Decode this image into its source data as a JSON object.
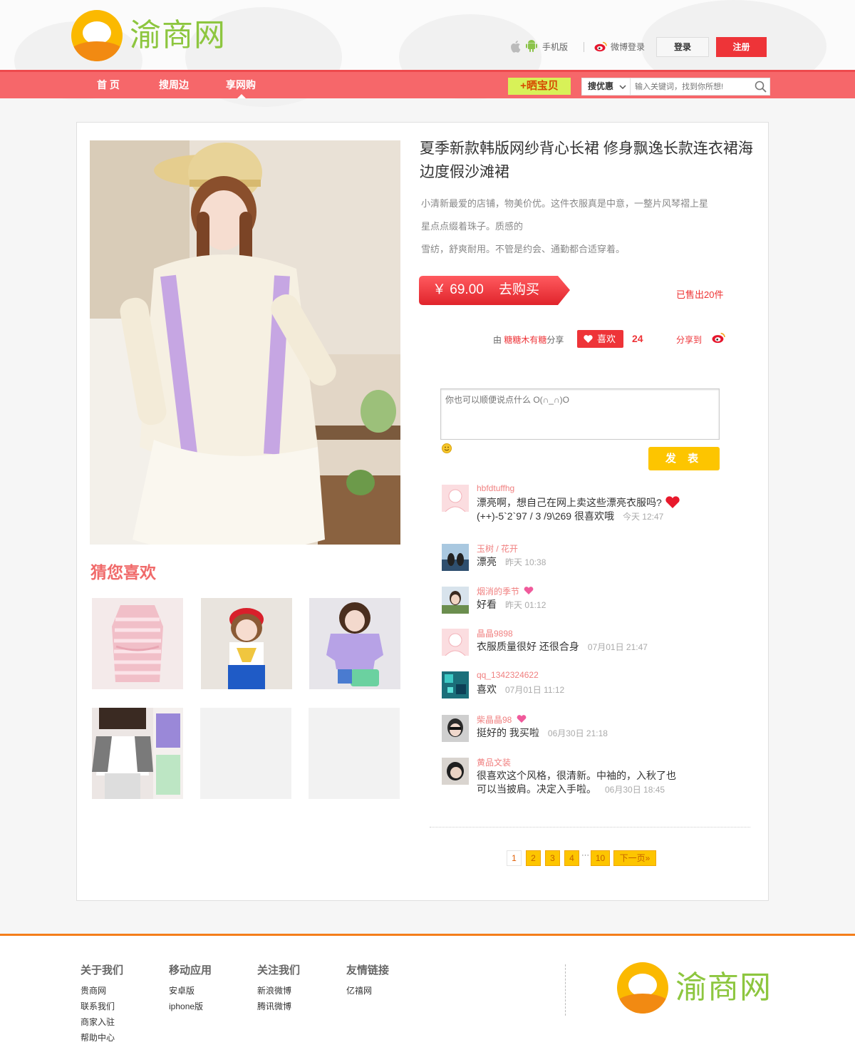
{
  "header": {
    "logo_text": "渝商网",
    "mobile_label": "手机版",
    "weibo_login_label": "微博登录",
    "login_button": "登录",
    "register_button": "注册"
  },
  "nav": {
    "items": [
      {
        "label": "首 页"
      },
      {
        "label": "搜周边"
      },
      {
        "label": "享网购"
      }
    ],
    "share_button": "+晒宝贝",
    "search_select": "搜优惠",
    "search_placeholder": "输入关键词，找到你所想!"
  },
  "product": {
    "title": "夏季新款韩版网纱背心长裙 修身飘逸长款连衣裙海边度假沙滩裙",
    "description_lines": [
      "小清新最爱的店铺，物美价优。这件衣服真是中意，一整片风琴褶上星",
      "星点点缀着珠子。质感的",
      "雪纺，舒爽耐用。不管是约会、通勤都合适穿着。"
    ],
    "price": "￥ 69.00",
    "buy_label": "去购买",
    "sold": "已售出20件",
    "shared_by_prefix": "由",
    "shared_by_user": "糖糖木有糖",
    "shared_by_suffix": "分享",
    "like_label": "喜欢",
    "like_count": "24",
    "share_to_label": "分享到"
  },
  "comment_form": {
    "placeholder": "你也可以顺便说点什么 O(∩_∩)O",
    "submit_label": "发 表"
  },
  "comments": [
    {
      "name": "hbfdtuffhg",
      "line1": "漂亮啊，想自己在网上卖这些漂亮衣服吗?",
      "line2": "(++)-5`2`97 / 3 /9\\269 很喜欢哦",
      "time": "今天 12:47"
    },
    {
      "name": "玉树 / 花开",
      "text": "漂亮",
      "time": "昨天 10:38"
    },
    {
      "name": "烟消的季节",
      "text": "好看",
      "time": "昨天 01:12"
    },
    {
      "name": "晶晶9898",
      "text": "衣服质量很好 还很合身",
      "time": "07月01日 21:47"
    },
    {
      "name": "qq_1342324622",
      "text": "喜欢",
      "time": "07月01日 11:12"
    },
    {
      "name": "柴晶晶98",
      "text": "挺好的 我买啦",
      "time": "06月30日 21:18"
    },
    {
      "name": "黄品文装",
      "line1": "很喜欢这个风格，很清新。中袖的，入秋了也",
      "line2": "可以当披肩。决定入手啦。",
      "time": "06月30日 18:45"
    }
  ],
  "pagination": {
    "pages": [
      "1",
      "2",
      "3",
      "4"
    ],
    "ellipsis": "···",
    "last": "10",
    "next": "下一页»",
    "current": "1"
  },
  "guess": {
    "title": "猜您喜欢"
  },
  "footer": {
    "columns": [
      {
        "title": "关于我们",
        "links": [
          "贵商网",
          "联系我们",
          "商家入驻",
          "帮助中心"
        ]
      },
      {
        "title": "移动应用",
        "links": [
          "安卓版",
          "iphone版"
        ]
      },
      {
        "title": "关注我们",
        "links": [
          "新浪微博",
          "腾讯微博"
        ]
      },
      {
        "title": "友情链接",
        "links": [
          "亿禧网"
        ]
      }
    ],
    "logo_text": "渝商网"
  },
  "colors": {
    "nav": "#f6676a",
    "accent_red": "#ee3438",
    "button_yellow": "#fdc500",
    "logo_green": "#8dc63f",
    "footer_line": "#f47e1a"
  }
}
